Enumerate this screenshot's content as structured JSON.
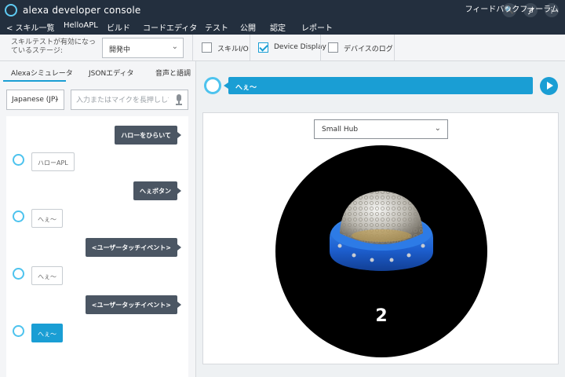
{
  "header": {
    "brand": "alexa developer console",
    "icons": [
      "search-icon",
      "account-icon",
      "more-icon"
    ],
    "account_glyph": "ア",
    "search_glyph": "🔍",
    "more_glyph": "⋮",
    "nav": [
      {
        "label": "< スキル一覧"
      },
      {
        "label": "HelloAPL"
      },
      {
        "label": "ビルド"
      },
      {
        "label": "コードエディタ"
      },
      {
        "label": "テスト"
      },
      {
        "label": "公開"
      },
      {
        "label": "認定"
      },
      {
        "label": "レポート"
      }
    ],
    "feedback": "フィードバックフォーラム"
  },
  "stage": {
    "label": "スキルテストが有効になっているステージ:",
    "value": "開発中",
    "options_toggle": [
      {
        "label": "スキルI/O",
        "checked": false
      },
      {
        "label": "Device Display",
        "checked": true
      },
      {
        "label": "デバイスのログ",
        "checked": false
      }
    ]
  },
  "simulator": {
    "tabs": [
      "Alexaシミュレータ",
      "JSONエディタ",
      "音声と語調"
    ],
    "language": "Japanese (JP)",
    "input_placeholder": "入力またはマイクを長押しして発話",
    "chat": [
      {
        "from": "user",
        "text": "ハローをひらいて"
      },
      {
        "from": "alexa",
        "text": "ハローAPL"
      },
      {
        "from": "user",
        "text": "へぇボタン"
      },
      {
        "from": "alexa",
        "text": "へぇ〜"
      },
      {
        "from": "user",
        "text": "<ユーザータッチイベント>"
      },
      {
        "from": "alexa",
        "text": "へぇ〜"
      },
      {
        "from": "user",
        "text": "<ユーザータッチイベント>"
      },
      {
        "from": "alexa",
        "text": "へぇ〜",
        "active": true
      }
    ]
  },
  "display": {
    "utterance": "へぇ〜",
    "device": "Small Hub",
    "count": "2"
  },
  "colors": {
    "topbar": "#232f3e",
    "accent": "#1a9ed4",
    "alexa_ring": "#4dc3ee",
    "user_bubble": "#4b5663"
  }
}
